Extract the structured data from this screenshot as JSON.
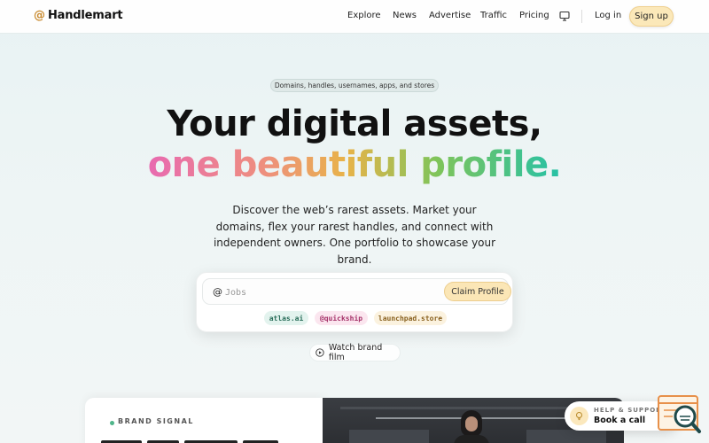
{
  "nav": {
    "brand_at": "@",
    "brand_name": "Handlemart",
    "links": [
      "Explore",
      "News",
      "Advertise",
      "Traffic",
      "Pricing"
    ],
    "monitor_icon": "monitor-icon",
    "login": "Log in",
    "signup": "Sign up"
  },
  "hero": {
    "pill": "Domains, handles, usernames, apps, and stores",
    "headline_1": "Your digital assets,",
    "headline_2": "one beautiful profile.",
    "description": "Discover the web’s rarest assets. Market your domains, flex your rarest handles, and connect with independent owners. One portfolio to showcase your brand."
  },
  "claim": {
    "at": "@",
    "placeholder": "Jobs",
    "button": "Claim Profile",
    "chips": [
      "atlas.ai",
      "@quickship",
      "launchpad.store"
    ]
  },
  "watch": {
    "label": "Watch brand film",
    "icon": "play-circle-icon"
  },
  "brand_signal": {
    "label": "BRAND SIGNAL"
  },
  "help": {
    "small": "HELP & SUPPORT",
    "big": "Book a call",
    "icon": "lightbulb-icon"
  },
  "colors": {
    "accent": "#fbe6b6",
    "accent_border": "#eccd8d",
    "brand_at": "#c88a2e",
    "gradient": [
      "#e86ab0",
      "#ee8f7e",
      "#e8b349",
      "#7fc45a",
      "#26c1a6"
    ]
  }
}
